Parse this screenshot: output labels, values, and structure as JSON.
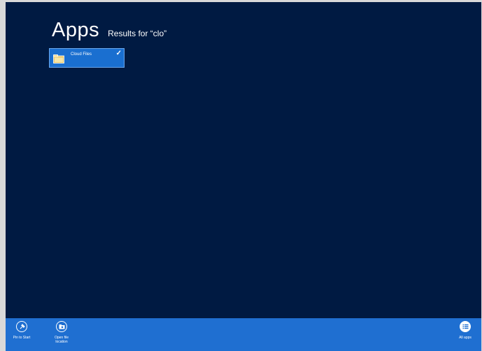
{
  "header": {
    "title": "Apps",
    "subtitle": "Results for “clo”"
  },
  "results": [
    {
      "label": "Cloud Files",
      "icon": "folder-icon",
      "selected": true
    }
  ],
  "appbar": {
    "pin_to_start": "Pin to Start",
    "open_file_location": "Open file location",
    "all_apps": "All apps"
  },
  "colors": {
    "background": "#001a42",
    "tile": "#1a6fd0",
    "appbar": "#1f6fd1"
  }
}
